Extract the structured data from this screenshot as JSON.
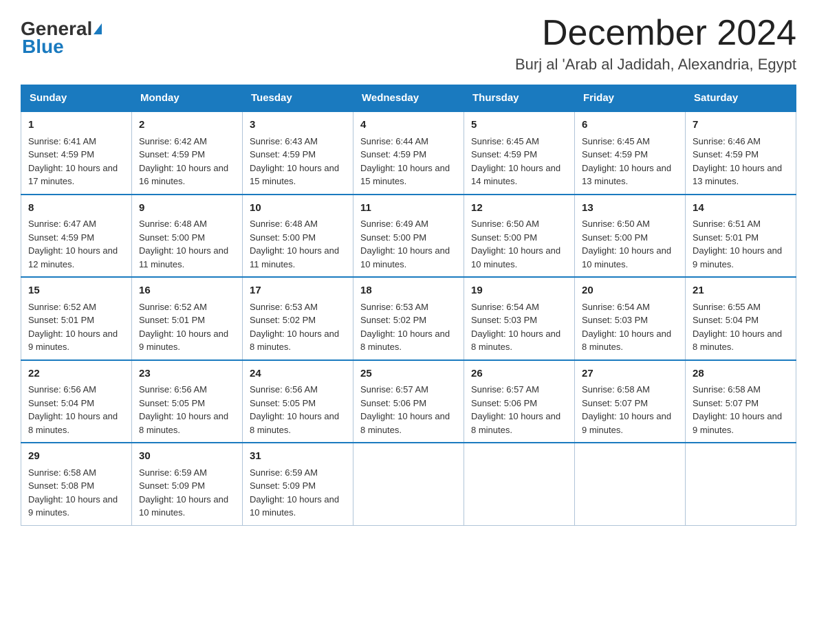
{
  "header": {
    "logo_general": "General",
    "logo_blue": "Blue",
    "month_title": "December 2024",
    "location": "Burj al 'Arab al Jadidah, Alexandria, Egypt"
  },
  "days_of_week": [
    "Sunday",
    "Monday",
    "Tuesday",
    "Wednesday",
    "Thursday",
    "Friday",
    "Saturday"
  ],
  "weeks": [
    [
      {
        "day": "1",
        "sunrise": "6:41 AM",
        "sunset": "4:59 PM",
        "daylight": "10 hours and 17 minutes."
      },
      {
        "day": "2",
        "sunrise": "6:42 AM",
        "sunset": "4:59 PM",
        "daylight": "10 hours and 16 minutes."
      },
      {
        "day": "3",
        "sunrise": "6:43 AM",
        "sunset": "4:59 PM",
        "daylight": "10 hours and 15 minutes."
      },
      {
        "day": "4",
        "sunrise": "6:44 AM",
        "sunset": "4:59 PM",
        "daylight": "10 hours and 15 minutes."
      },
      {
        "day": "5",
        "sunrise": "6:45 AM",
        "sunset": "4:59 PM",
        "daylight": "10 hours and 14 minutes."
      },
      {
        "day": "6",
        "sunrise": "6:45 AM",
        "sunset": "4:59 PM",
        "daylight": "10 hours and 13 minutes."
      },
      {
        "day": "7",
        "sunrise": "6:46 AM",
        "sunset": "4:59 PM",
        "daylight": "10 hours and 13 minutes."
      }
    ],
    [
      {
        "day": "8",
        "sunrise": "6:47 AM",
        "sunset": "4:59 PM",
        "daylight": "10 hours and 12 minutes."
      },
      {
        "day": "9",
        "sunrise": "6:48 AM",
        "sunset": "5:00 PM",
        "daylight": "10 hours and 11 minutes."
      },
      {
        "day": "10",
        "sunrise": "6:48 AM",
        "sunset": "5:00 PM",
        "daylight": "10 hours and 11 minutes."
      },
      {
        "day": "11",
        "sunrise": "6:49 AM",
        "sunset": "5:00 PM",
        "daylight": "10 hours and 10 minutes."
      },
      {
        "day": "12",
        "sunrise": "6:50 AM",
        "sunset": "5:00 PM",
        "daylight": "10 hours and 10 minutes."
      },
      {
        "day": "13",
        "sunrise": "6:50 AM",
        "sunset": "5:00 PM",
        "daylight": "10 hours and 10 minutes."
      },
      {
        "day": "14",
        "sunrise": "6:51 AM",
        "sunset": "5:01 PM",
        "daylight": "10 hours and 9 minutes."
      }
    ],
    [
      {
        "day": "15",
        "sunrise": "6:52 AM",
        "sunset": "5:01 PM",
        "daylight": "10 hours and 9 minutes."
      },
      {
        "day": "16",
        "sunrise": "6:52 AM",
        "sunset": "5:01 PM",
        "daylight": "10 hours and 9 minutes."
      },
      {
        "day": "17",
        "sunrise": "6:53 AM",
        "sunset": "5:02 PM",
        "daylight": "10 hours and 8 minutes."
      },
      {
        "day": "18",
        "sunrise": "6:53 AM",
        "sunset": "5:02 PM",
        "daylight": "10 hours and 8 minutes."
      },
      {
        "day": "19",
        "sunrise": "6:54 AM",
        "sunset": "5:03 PM",
        "daylight": "10 hours and 8 minutes."
      },
      {
        "day": "20",
        "sunrise": "6:54 AM",
        "sunset": "5:03 PM",
        "daylight": "10 hours and 8 minutes."
      },
      {
        "day": "21",
        "sunrise": "6:55 AM",
        "sunset": "5:04 PM",
        "daylight": "10 hours and 8 minutes."
      }
    ],
    [
      {
        "day": "22",
        "sunrise": "6:56 AM",
        "sunset": "5:04 PM",
        "daylight": "10 hours and 8 minutes."
      },
      {
        "day": "23",
        "sunrise": "6:56 AM",
        "sunset": "5:05 PM",
        "daylight": "10 hours and 8 minutes."
      },
      {
        "day": "24",
        "sunrise": "6:56 AM",
        "sunset": "5:05 PM",
        "daylight": "10 hours and 8 minutes."
      },
      {
        "day": "25",
        "sunrise": "6:57 AM",
        "sunset": "5:06 PM",
        "daylight": "10 hours and 8 minutes."
      },
      {
        "day": "26",
        "sunrise": "6:57 AM",
        "sunset": "5:06 PM",
        "daylight": "10 hours and 8 minutes."
      },
      {
        "day": "27",
        "sunrise": "6:58 AM",
        "sunset": "5:07 PM",
        "daylight": "10 hours and 9 minutes."
      },
      {
        "day": "28",
        "sunrise": "6:58 AM",
        "sunset": "5:07 PM",
        "daylight": "10 hours and 9 minutes."
      }
    ],
    [
      {
        "day": "29",
        "sunrise": "6:58 AM",
        "sunset": "5:08 PM",
        "daylight": "10 hours and 9 minutes."
      },
      {
        "day": "30",
        "sunrise": "6:59 AM",
        "sunset": "5:09 PM",
        "daylight": "10 hours and 10 minutes."
      },
      {
        "day": "31",
        "sunrise": "6:59 AM",
        "sunset": "5:09 PM",
        "daylight": "10 hours and 10 minutes."
      },
      null,
      null,
      null,
      null
    ]
  ],
  "labels": {
    "sunrise": "Sunrise:",
    "sunset": "Sunset:",
    "daylight": "Daylight:"
  }
}
